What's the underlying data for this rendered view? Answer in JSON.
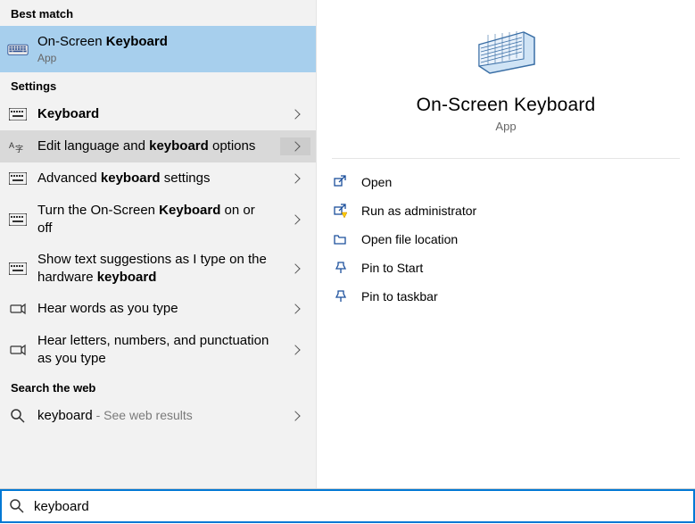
{
  "sections": {
    "best_match": "Best match",
    "settings": "Settings",
    "search_web": "Search the web"
  },
  "best_match_item": {
    "title": "On-Screen Keyboard",
    "subtitle": "App"
  },
  "settings_items": [
    {
      "label": "Keyboard"
    },
    {
      "label": "Edit language and keyboard options"
    },
    {
      "label": "Advanced keyboard settings"
    },
    {
      "label": "Turn the On-Screen Keyboard on or off"
    },
    {
      "label": "Show text suggestions as I type on the hardware keyboard"
    },
    {
      "label": "Hear words as you type"
    },
    {
      "label": "Hear letters, numbers, and punctuation as you type"
    }
  ],
  "web_item": {
    "label": "keyboard",
    "suffix": " - See web results"
  },
  "preview": {
    "title": "On-Screen Keyboard",
    "subtitle": "App",
    "actions": [
      "Open",
      "Run as administrator",
      "Open file location",
      "Pin to Start",
      "Pin to taskbar"
    ]
  },
  "search_value": "keyboard"
}
